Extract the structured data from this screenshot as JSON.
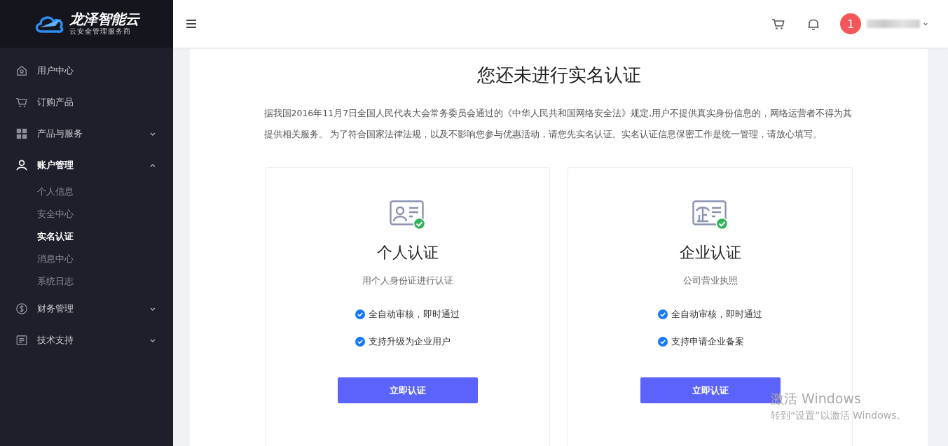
{
  "logo": {
    "name": "龙泽智能云",
    "tagline": "云安全管理服务商"
  },
  "sidebar": {
    "items": [
      {
        "label": "用户中心"
      },
      {
        "label": "订购产品"
      },
      {
        "label": "产品与服务",
        "expanded": false
      },
      {
        "label": "账户管理",
        "expanded": true,
        "children": [
          {
            "label": "个人信息",
            "selected": false
          },
          {
            "label": "安全中心",
            "selected": false
          },
          {
            "label": "实名认证",
            "selected": true
          },
          {
            "label": "消息中心",
            "selected": false
          },
          {
            "label": "系统日志",
            "selected": false
          }
        ]
      },
      {
        "label": "财务管理",
        "expanded": false
      },
      {
        "label": "技术支持",
        "expanded": false
      }
    ]
  },
  "header": {
    "notification_count": "1"
  },
  "main": {
    "title": "您还未进行实名认证",
    "notice": "据我国2016年11月7日全国人民代表大会常务委员会通过的《中华人民共和国网络安全法》规定,用户不提供真实身份信息的，网络运营者不得为其提供相关服务。 为了符合国家法律法规，以及不影响您参与优惠活动，请您先实名认证。实名认证信息保密工作是统一管理，请放心填写。",
    "cards": [
      {
        "kind": "personal",
        "title": "个人认证",
        "subtitle": "用个人身份证进行认证",
        "features": [
          "全自动审核，即时通过",
          "支持升级为企业用户"
        ],
        "button": "立即认证"
      },
      {
        "kind": "enterprise",
        "title": "企业认证",
        "subtitle": "公司营业执照",
        "features": [
          "全自动审核，即时通过",
          "支持申请企业备案"
        ],
        "button": "立即认证"
      }
    ]
  },
  "os_overlay": {
    "title": "激活 Windows",
    "hint": "转到“设置”以激活 Windows。"
  }
}
